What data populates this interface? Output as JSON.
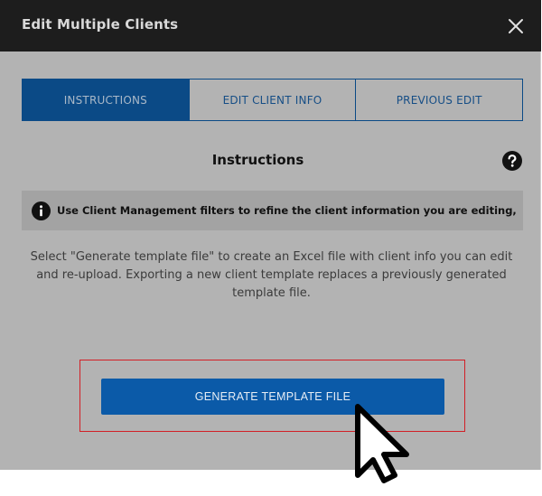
{
  "dialog": {
    "title": "Edit Multiple Clients",
    "close_icon": "close-icon"
  },
  "tabs": [
    {
      "label": "INSTRUCTIONS",
      "active": true
    },
    {
      "label": "EDIT CLIENT INFO",
      "active": false
    },
    {
      "label": "PREVIOUS EDIT",
      "active": false
    }
  ],
  "instructions": {
    "title": "Instructions",
    "help_icon": "question-circle-icon",
    "info_icon": "info-circle-icon",
    "info_text": "Use Client Management filters to refine the client information you are editing,",
    "description": "Select \"Generate template file\" to create an Excel file with client info you can edit and re-upload. Exporting a new client template replaces a previously generated template file."
  },
  "actions": {
    "generate_label": "GENERATE TEMPLATE FILE"
  },
  "colors": {
    "header_bg": "#1d1d1d",
    "panel_bg": "#b3b3b3",
    "tab_active_bg": "#0b4a86",
    "button_bg": "#0b5aa8",
    "highlight_border": "#d21f26"
  }
}
